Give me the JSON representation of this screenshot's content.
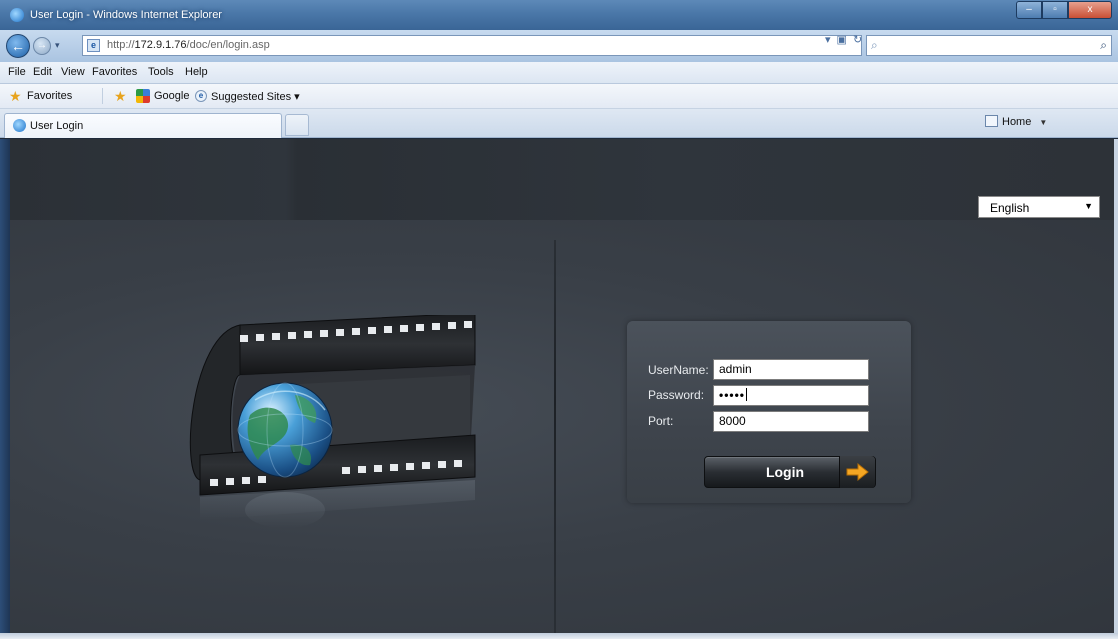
{
  "window": {
    "title": "User Login - Windows Internet Explorer",
    "buttons": [
      "minimize",
      "maximize",
      "close"
    ]
  },
  "address_bar": {
    "url_prefix": "http://",
    "url_host": "172.9.1.76",
    "url_path": "/doc/en/login.asp"
  },
  "menu": [
    "File",
    "Edit",
    "View",
    "Favorites",
    "Tools",
    "Help"
  ],
  "favorites_bar": {
    "favorites_label": "Favorites",
    "google_label": "Google",
    "suggested_label": "Suggested Sites ▾"
  },
  "tabs": {
    "active_tab": "User Login",
    "home_label": "Home"
  },
  "page": {
    "language": "English",
    "login_form": {
      "username_label": "UserName:",
      "username_value": "admin",
      "password_label": "Password:",
      "password_mask": "•••••",
      "port_label": "Port:",
      "port_value": "8000",
      "login_button": "Login"
    }
  },
  "colors": {
    "page_background": "#353b43",
    "panel_background": "#454b53",
    "accent_arrow": "#f5a623"
  },
  "icons": [
    "ie-icon",
    "back-icon",
    "forward-icon",
    "refresh-icon",
    "stop-icon",
    "search-icon",
    "favorites-star-icon",
    "google-icon",
    "home-icon",
    "arrow-right-icon"
  ]
}
